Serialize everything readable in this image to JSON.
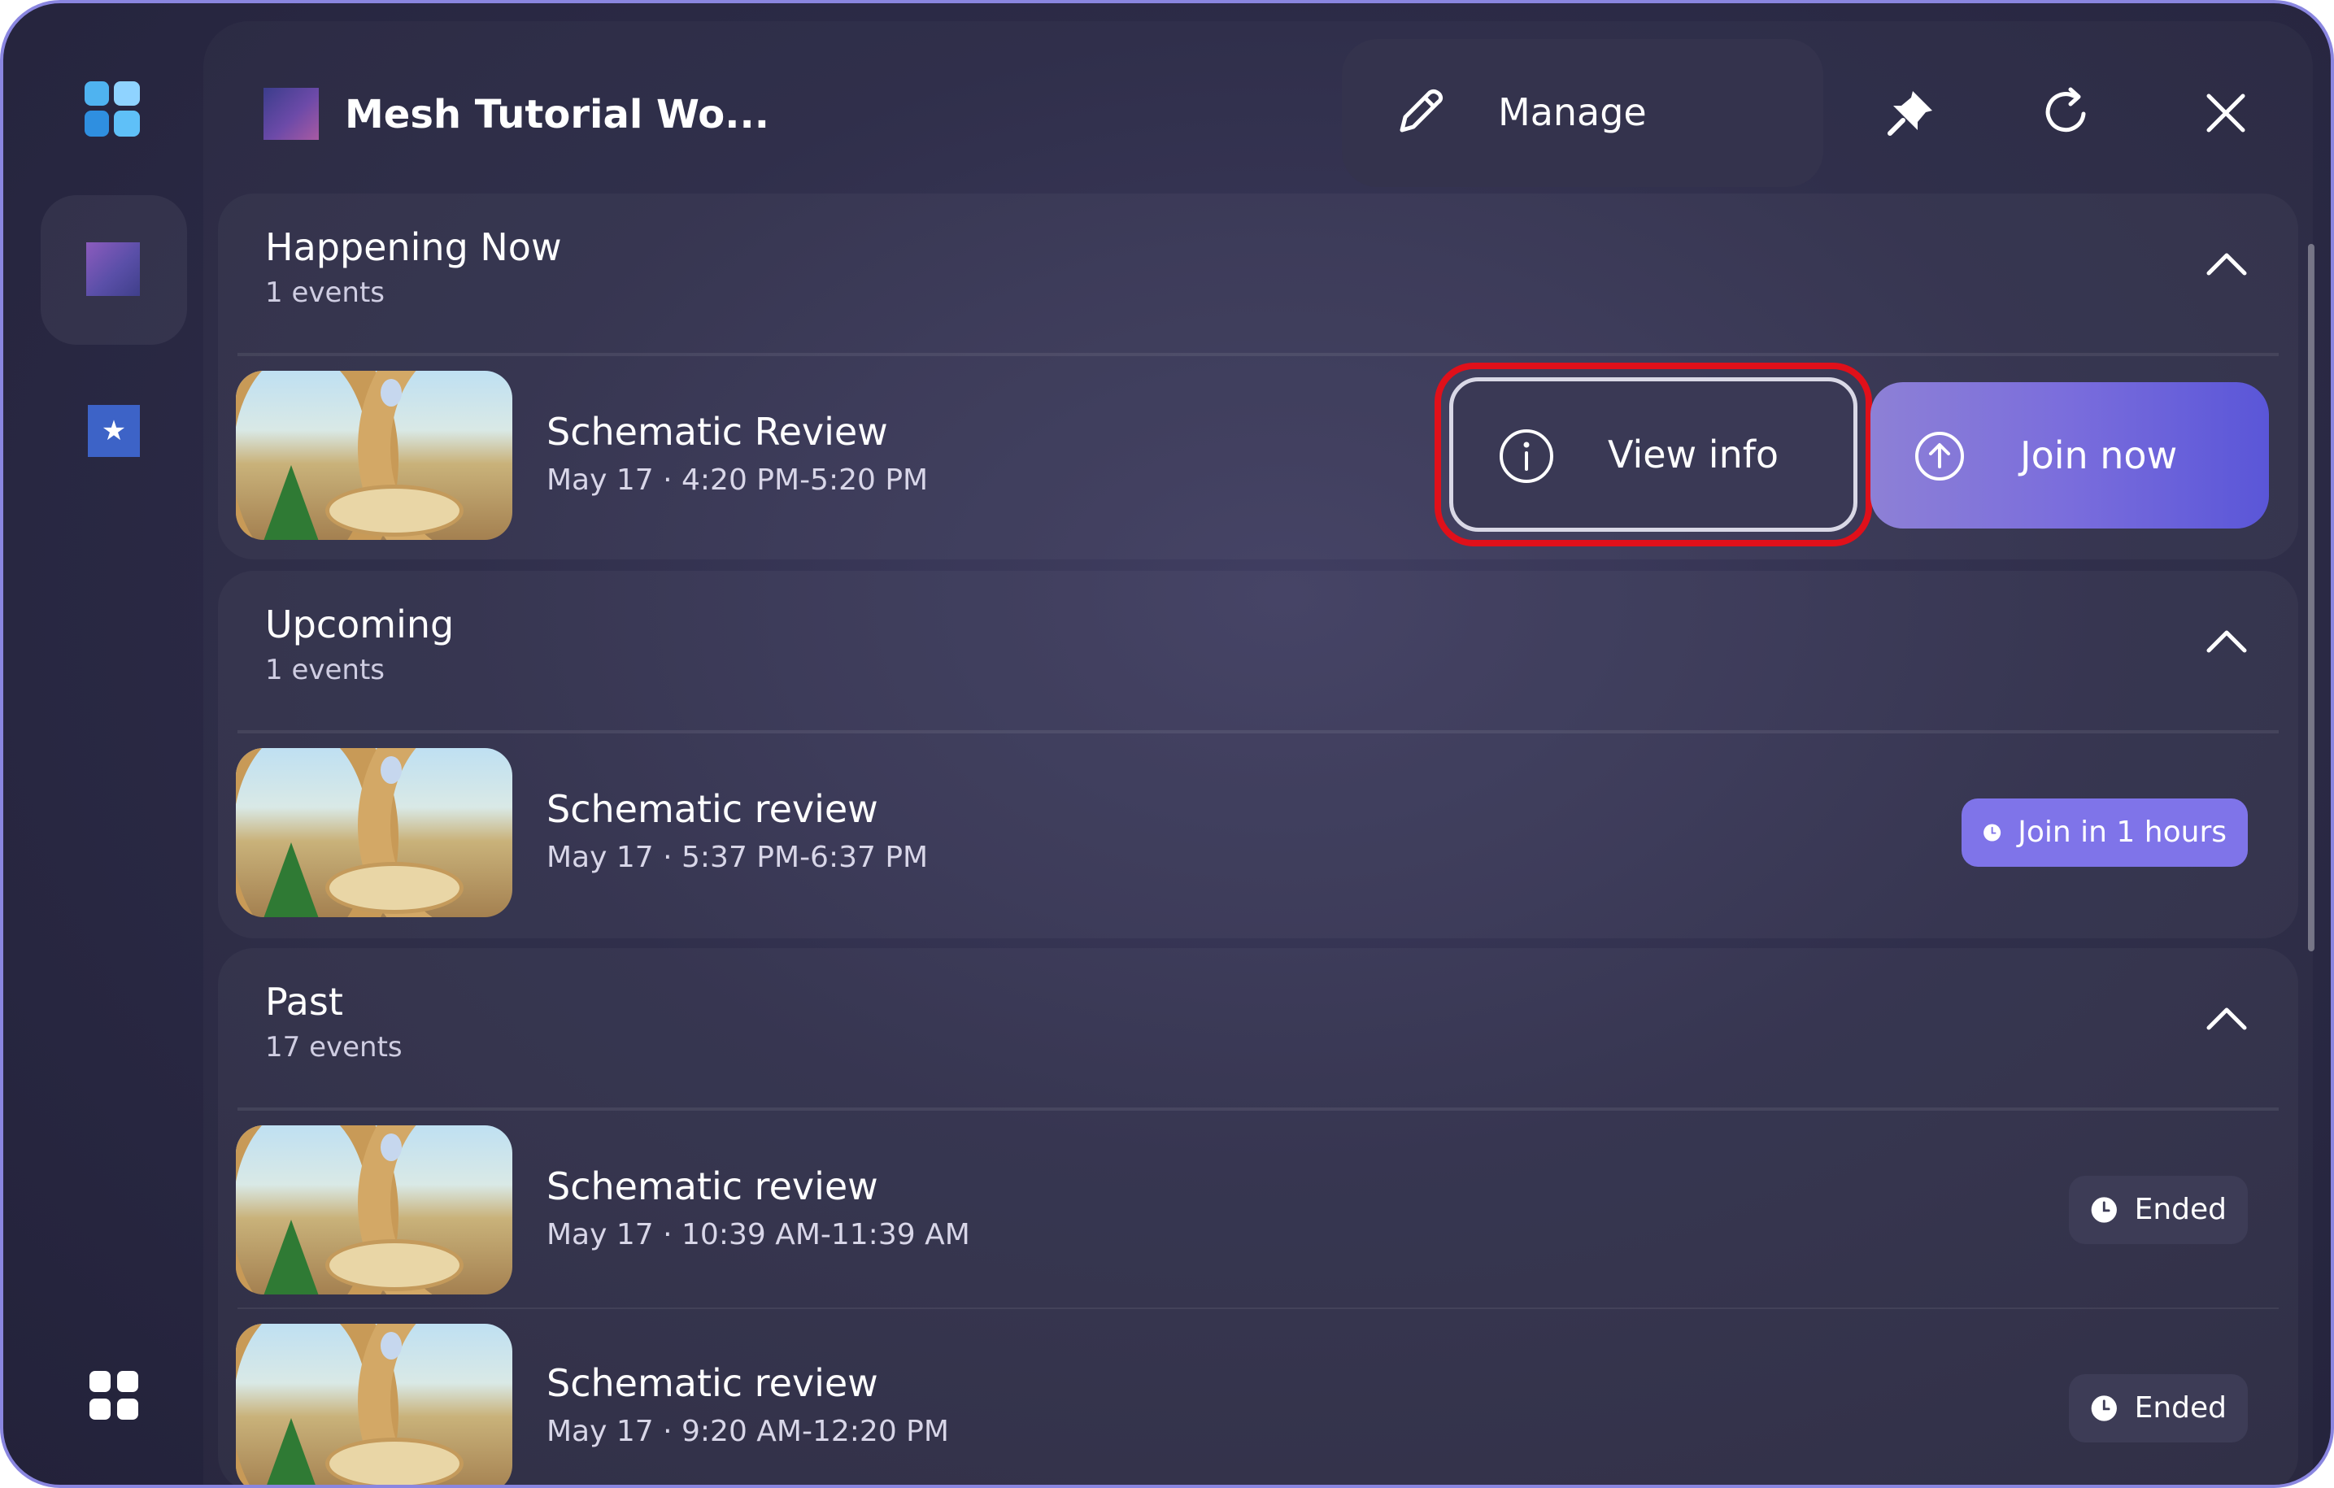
{
  "app": {
    "title": "Mesh Tutorial Wo...",
    "manage_label": "Manage"
  },
  "rail": {
    "icons": [
      "windows-grid-icon",
      "workspace-thumbnail",
      "star-icon",
      "apps-icon"
    ]
  },
  "header": {
    "icons": [
      "pencil-icon",
      "pin-icon",
      "refresh-icon",
      "close-icon"
    ]
  },
  "sections": {
    "happening_now": {
      "title": "Happening Now",
      "count": "1 events",
      "events": [
        {
          "title": "Schematic Review",
          "time": "May 17 · 4:20 PM-5:20 PM",
          "view_info_label": "View info",
          "join_label": "Join now"
        }
      ]
    },
    "upcoming": {
      "title": "Upcoming",
      "count": "1 events",
      "events": [
        {
          "title": "Schematic review",
          "time": "May 17 · 5:37 PM-6:37 PM",
          "status": "Join in 1 hours"
        }
      ]
    },
    "past": {
      "title": "Past",
      "count": "17 events",
      "events": [
        {
          "title": "Schematic review",
          "time": "May 17 · 10:39 AM-11:39 AM",
          "status": "Ended"
        },
        {
          "title": "Schematic review",
          "time": "May 17 · 9:20 AM-12:20 PM",
          "status": "Ended"
        }
      ]
    }
  },
  "colors": {
    "background": "#2c2b47",
    "accent": "#7f74e9",
    "highlight_ring": "#e0101a",
    "window_border": "#8a86e0"
  }
}
